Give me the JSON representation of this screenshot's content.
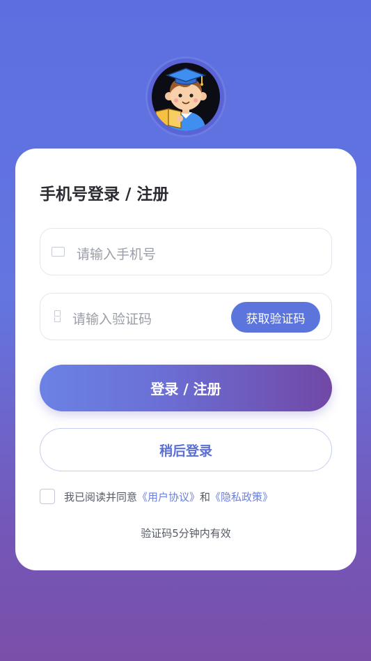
{
  "avatar": {
    "icon": "student-reading-avatar-icon"
  },
  "login": {
    "title": "手机号登录 / 注册",
    "phone_placeholder": "请输入手机号",
    "code_placeholder": "请输入验证码",
    "get_code_label": "获取验证码",
    "login_button_label": "登录 / 注册",
    "later_button_label": "稍后登录",
    "agree_prefix": "我已阅读并同意",
    "user_agreement_link": "《用户协议》",
    "agree_and": "和",
    "privacy_policy_link": "《隐私政策》",
    "code_validity_note": "验证码5分钟内有效"
  },
  "colors": {
    "accent": "#5b75dd",
    "gradient_end": "#7148a6",
    "background_top": "#5d6fe0",
    "background_bottom": "#7a4fa9"
  }
}
